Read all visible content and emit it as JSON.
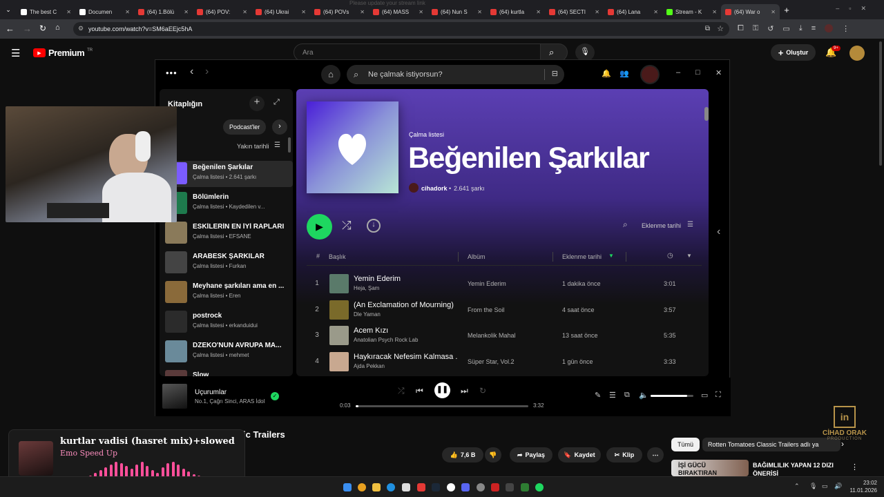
{
  "browser": {
    "tabs": [
      {
        "label": "The best C",
        "color": "#ffffff"
      },
      {
        "label": "Documen",
        "color": "#ffffff"
      },
      {
        "label": "(64) 1.Bölü",
        "color": "#e53935"
      },
      {
        "label": "(64) POV:",
        "color": "#e53935"
      },
      {
        "label": "(64) Ukrai",
        "color": "#e53935"
      },
      {
        "label": "(64) POVs",
        "color": "#e53935"
      },
      {
        "label": "(64) MASS",
        "color": "#e53935"
      },
      {
        "label": "(64) Nun S",
        "color": "#e53935"
      },
      {
        "label": "(64) kurtla",
        "color": "#e53935"
      },
      {
        "label": "(64) SECTI",
        "color": "#e53935"
      },
      {
        "label": "(64) Lana",
        "color": "#e53935"
      },
      {
        "label": "Stream - K",
        "color": "#53fc18"
      },
      {
        "label": "(64) War o",
        "color": "#e53935"
      }
    ],
    "faded_tab_text": "Please update your stream link",
    "url": "youtube.com/watch?v=SM6aEEjc5hA"
  },
  "youtube": {
    "logo_text": "Premium",
    "logo_badge": "TR",
    "search_placeholder": "Ara",
    "create_label": "Oluştur",
    "notif_badge": "9+",
    "video_title_fragment": "ic Trailers",
    "like_count": "7,6 B",
    "share_label": "Paylaş",
    "save_label": "Kaydet",
    "clip_label": "Klip",
    "chip_all": "Tümü",
    "chip_channel": "Rotten Tomatoes Classic Trailers adlı ya",
    "rec_title_line1": "BAĞIMLILIK YAPAN 12 DIZI",
    "rec_title_line2": "ÖNERİSİ",
    "rec_thumb_text_1": "İŞİ GÜCÜ",
    "rec_thumb_text_2": "BIRAKTIRAN"
  },
  "spotify": {
    "search_placeholder": "Ne çalmak istiyorsun?",
    "library": {
      "title": "Kitaplığın",
      "filter_chip": "Podcast'ler",
      "sort_label": "Yakın tarihli",
      "items": [
        {
          "title": "Beğenilen Şarkılar",
          "subtitle": "Çalma listesi • 2.641 şarkı",
          "color": "#7b5cff"
        },
        {
          "title": "Bölümlerin",
          "subtitle": "Çalma listesi • Kaydedilen v...",
          "color": "#1e7a4d"
        },
        {
          "title": "ESKİLERİN EN İYİ RAPLARI",
          "subtitle": "Çalma listesi • EFSANE",
          "color": "#8a7a5a"
        },
        {
          "title": "ARABESK ŞARKILAR",
          "subtitle": "Çalma listesi • Furkan",
          "color": "#444444"
        },
        {
          "title": "Meyhane şarkıları ama en ...",
          "subtitle": "Çalma listesi • Eren",
          "color": "#8a6a3a"
        },
        {
          "title": "postrock",
          "subtitle": "Çalma listesi • erkanduidui",
          "color": "#2b2b2b"
        },
        {
          "title": "DZEKO'NUN AVRUPA MA...",
          "subtitle": "Çalma listesi • mehmet",
          "color": "#6a8a9a"
        },
        {
          "title": "Slow",
          "subtitle": "",
          "color": "#5a3a3a"
        }
      ]
    },
    "playlist": {
      "type_label": "Çalma listesi",
      "title": "Beğenilen Şarkılar",
      "owner": "cihadork",
      "count": "2.641 şarkı",
      "sort_label": "Eklenme tarihi",
      "columns": {
        "number": "#",
        "title": "Başlık",
        "album": "Albüm",
        "date": "Eklenme tarihi"
      },
      "tracks": [
        {
          "n": "1",
          "title": "Yemin Ederim",
          "artist": "Heja, Şam",
          "album": "Yemin Ederim",
          "added": "1 dakika önce",
          "duration": "3:01",
          "color": "#5a7a6a"
        },
        {
          "n": "2",
          "title": "(An Exclamation of Mourning)",
          "artist": "Dle Yaman",
          "album": "From the Soil",
          "added": "4 saat önce",
          "duration": "3:57",
          "color": "#7a6a2a"
        },
        {
          "n": "3",
          "title": "Acem Kızı",
          "artist": "Anatolian Psych Rock Lab",
          "album": "Melankolik Mahal",
          "added": "13 saat önce",
          "duration": "5:35",
          "color": "#9a9a8a"
        },
        {
          "n": "4",
          "title": "Haykıracak Nefesim Kalmasa ...",
          "artist": "Ajda Pekkan",
          "album": "Süper Star, Vol.2",
          "added": "1 gün önce",
          "duration": "3:33",
          "color": "#c8a890"
        }
      ]
    },
    "now_playing": {
      "title": "Uçurumlar",
      "artist": "No.1, Çağrı Sinci, ARAS İdol",
      "elapsed": "0:03",
      "total": "3:32",
      "progress": 0.015,
      "volume": 0.85
    }
  },
  "overlay": {
    "now_playing_title": "kurtlar vadisi (hasret mix)+slowed",
    "now_playing_artist": "Emo Speed Up",
    "watermark_line1": "CİHAD ORAK",
    "watermark_line2": "PRODUCTION",
    "watermark_logo": "in"
  },
  "taskbar": {
    "time": "23:02",
    "date": "11.01.2026"
  },
  "colors": {
    "spotify_green": "#1ed760",
    "playlist_gradient_top": "#5b3fb3",
    "youtube_red": "#ff0000",
    "eq_pink": "#ff4f9a"
  }
}
